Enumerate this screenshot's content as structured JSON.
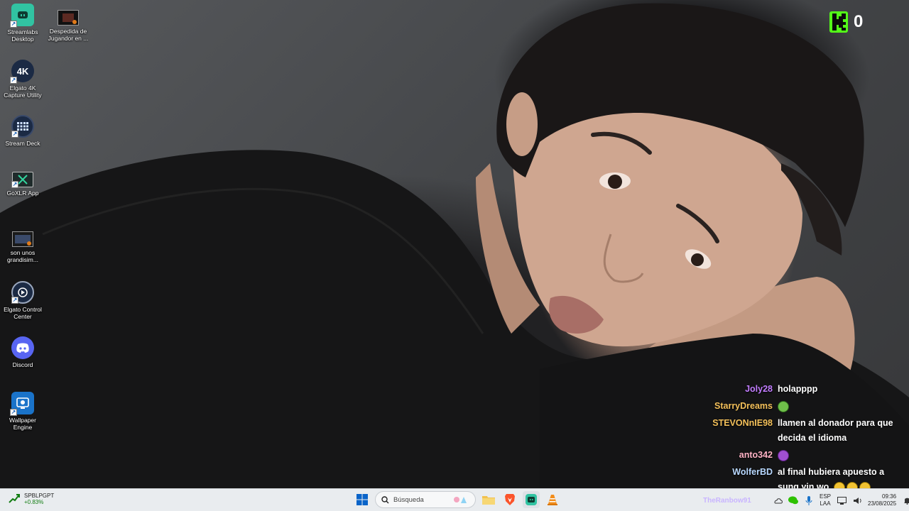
{
  "desktop": {
    "icons": [
      {
        "label": "Streamlabs Desktop",
        "icon": "streamlabs-icon",
        "color": "#31c3a2"
      },
      {
        "label": "Despedida de Jugandor en ...",
        "icon": "video-file-icon",
        "color": "#2b2b2b"
      },
      {
        "label": "Elgato 4K Capture Utility",
        "icon": "elgato-4k-icon",
        "color": "#1b2a44",
        "glyph": "4K"
      },
      {
        "label": "Stream Deck",
        "icon": "stream-deck-icon",
        "color": "#1b2a44"
      },
      {
        "label": "GoXLR App",
        "icon": "goxlr-icon",
        "color": "#1f2b2b"
      },
      {
        "label": "son unos grandisim...",
        "icon": "video-file-icon",
        "color": "#2b2b2b"
      },
      {
        "label": "Elgato Control Center",
        "icon": "elgato-control-icon",
        "color": "#1b2a44"
      },
      {
        "label": "Discord",
        "icon": "discord-icon",
        "color": "#5865f2"
      },
      {
        "label": "Wallpaper Engine",
        "icon": "wallpaper-engine-icon",
        "color": "#1a73c9"
      }
    ]
  },
  "kick_counter": {
    "count": "0",
    "color": "#53fc18"
  },
  "chat": {
    "messages": [
      {
        "user": "Joly28",
        "color": "#c27dff",
        "text": "holapppp"
      },
      {
        "user": "StarryDreams",
        "color": "#f3c05a",
        "text": "",
        "emote": "frog-emote"
      },
      {
        "user": "STEVONnIE98",
        "color": "#f3c05a",
        "text": "llamen al donador para que decida el idioma"
      },
      {
        "user": "anto342",
        "color": "#ffb3c6",
        "text": "",
        "emote": "purple-emote"
      },
      {
        "user": "WolferBD",
        "color": "#b8d8ff",
        "text": "al final hubiera apuesto a sung yin wo.",
        "emote": "laugh-emotes"
      }
    ]
  },
  "taskbar": {
    "stock_name": "SPBLPGPT",
    "stock_change": "+0.83%",
    "search_placeholder": "Búsqueda",
    "tray_ticker": "TheRanbow91",
    "lang_top": "ESP",
    "lang_bottom": "LAA",
    "time": "09:36",
    "date": "23/08/2025"
  }
}
